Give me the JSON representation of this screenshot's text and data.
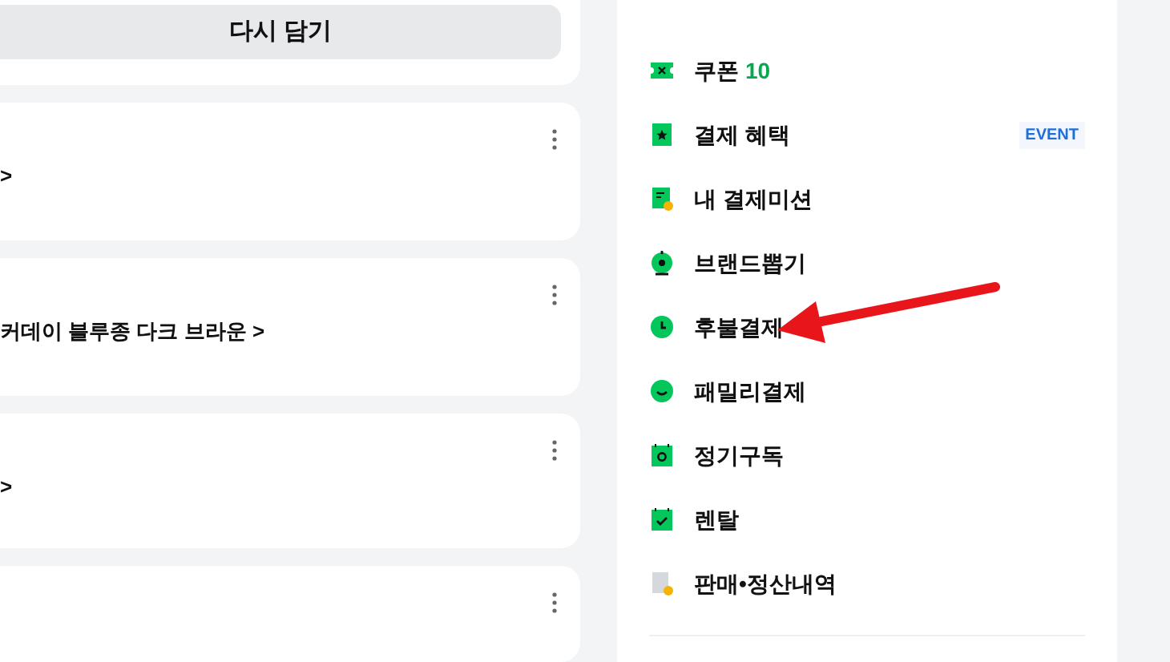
{
  "cart": {
    "reload_button": "다시 담기",
    "cards": [
      {
        "title": ">"
      },
      {
        "title": "커데이 블루종 다크 브라운 >"
      },
      {
        "title": ">"
      }
    ]
  },
  "menu": {
    "items": [
      {
        "label": "쿠폰",
        "count": "10"
      },
      {
        "label": "결제 혜택",
        "badge": "EVENT"
      },
      {
        "label": "내 결제미션"
      },
      {
        "label": "브랜드뽑기"
      },
      {
        "label": "후불결제"
      },
      {
        "label": "패밀리결제"
      },
      {
        "label": "정기구독"
      },
      {
        "label": "렌탈"
      },
      {
        "label": "판매•정산내역"
      }
    ]
  }
}
